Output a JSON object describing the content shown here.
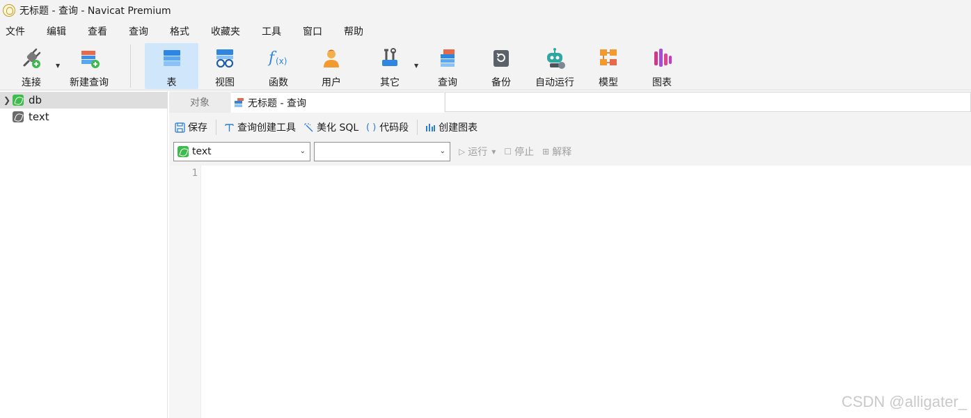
{
  "window": {
    "title": "无标题 - 查询 - Navicat Premium"
  },
  "menu": [
    "文件",
    "编辑",
    "查看",
    "查询",
    "格式",
    "收藏夹",
    "工具",
    "窗口",
    "帮助"
  ],
  "toolbar": {
    "connect": "连接",
    "new_query": "新建查询",
    "table": "表",
    "view": "视图",
    "function": "函数",
    "user": "用户",
    "other": "其它",
    "query": "查询",
    "backup": "备份",
    "automation": "自动运行",
    "model": "模型",
    "chart": "图表"
  },
  "sidebar": {
    "items": [
      {
        "label": "db",
        "selected": true,
        "expandable": true
      },
      {
        "label": "text",
        "selected": false,
        "expandable": false
      }
    ]
  },
  "tabs": {
    "objects": "对象",
    "query": "无标题 - 查询"
  },
  "query_toolbar": {
    "save": "保存",
    "query_builder": "查询创建工具",
    "beautify_sql": "美化 SQL",
    "code_snippet": "代码段",
    "create_chart": "创建图表"
  },
  "selectors": {
    "connection": "text",
    "database": ""
  },
  "run_controls": {
    "run": "运行",
    "stop": "停止",
    "explain": "解释"
  },
  "editor": {
    "line_numbers": [
      "1"
    ]
  },
  "watermark": "CSDN @alligater_"
}
